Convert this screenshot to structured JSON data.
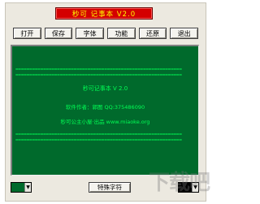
{
  "window": {
    "title": "秒可 记事本 V2.0"
  },
  "toolbar": {
    "buttons": [
      {
        "label": "打开"
      },
      {
        "label": "保存"
      },
      {
        "label": "字体"
      },
      {
        "label": "功能"
      },
      {
        "label": "还原"
      },
      {
        "label": "退出"
      }
    ]
  },
  "screen": {
    "dash_line": "============================================================",
    "app_name": "秒可记事本 V 2.0",
    "author_line": "软件作者：郭图   QQ:375486090",
    "publisher_line": "秒可公主小屋·出品  www.miaoke.org",
    "text_color": "#00ff55",
    "background": "#006a2c"
  },
  "bottom_bar": {
    "left_color": "#006a2c",
    "right_color": "#000000",
    "dropdown_arrow": "▼",
    "special_button": "特殊字符"
  },
  "watermark": {
    "text": "下载吧"
  }
}
